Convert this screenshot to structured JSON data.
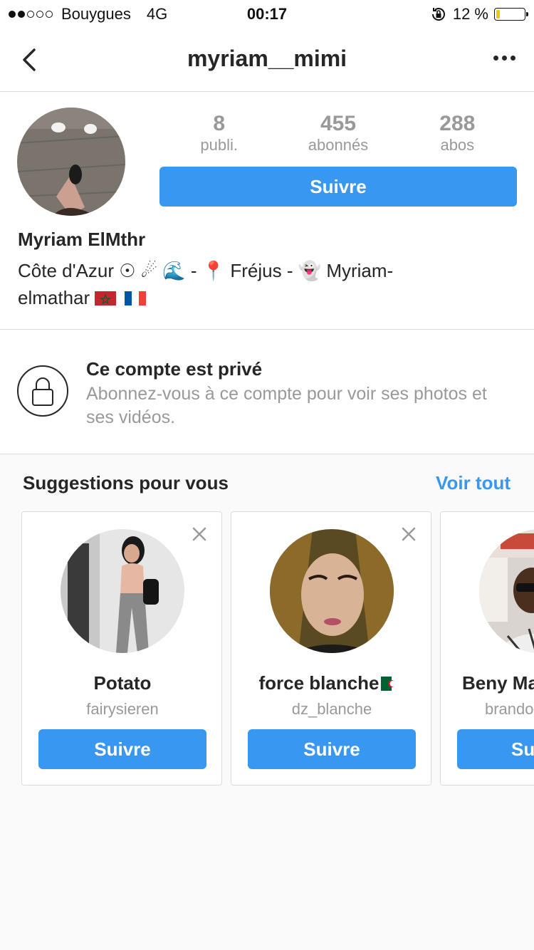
{
  "status_bar": {
    "carrier": "Bouygues",
    "network": "4G",
    "time": "00:17",
    "battery": "12 %",
    "battery_level": 0.12
  },
  "nav": {
    "title": "myriam__mimi"
  },
  "profile": {
    "stats": [
      {
        "value": "8",
        "label": "publi."
      },
      {
        "value": "455",
        "label": "abonnés"
      },
      {
        "value": "288",
        "label": "abos"
      }
    ],
    "follow_label": "Suivre",
    "full_name": "Myriam ElMthr",
    "bio_part1": "Côte d'Azur ☉ ☄ 🌊 - 📍 Fréjus - 👻 Myriam-",
    "bio_part2": "elmathar"
  },
  "private": {
    "title": "Ce compte est privé",
    "description": "Abonnez-vous à ce compte pour voir ses photos et ses vidéos."
  },
  "suggestions": {
    "heading": "Suggestions pour vous",
    "see_all": "Voir tout",
    "cards": [
      {
        "name": "Potato",
        "username": "fairysieren",
        "button": "Suivre"
      },
      {
        "name": "force blanche",
        "username": "dz_blanche",
        "button": "Suivre"
      },
      {
        "name": "Beny Ma",
        "username": "brando",
        "button": "Su"
      }
    ]
  },
  "colors": {
    "accent": "#3897f0",
    "muted_text": "#999999",
    "border": "#dbdbdb"
  }
}
